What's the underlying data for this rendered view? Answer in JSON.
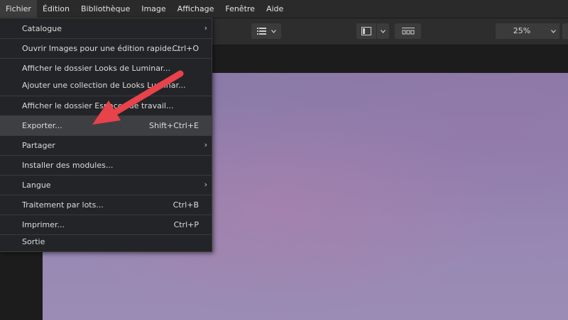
{
  "menubar": {
    "items": [
      "Fichier",
      "Édition",
      "Bibliothèque",
      "Image",
      "Affichage",
      "Fenêtre",
      "Aide"
    ]
  },
  "toolbar": {
    "zoom_value": "25%",
    "icons": [
      "list-view-icon",
      "panel-layout-icon",
      "filmstrip-icon"
    ]
  },
  "file_menu": {
    "items": [
      {
        "label": "Catalogue",
        "shortcut": "",
        "submenu": true
      },
      {
        "label": "Ouvrir Images pour une édition rapide...",
        "shortcut": "Ctrl+O",
        "submenu": false
      },
      {
        "label": "Afficher le dossier Looks de Luminar...",
        "shortcut": "",
        "submenu": false
      },
      {
        "label": "Ajouter une collection de Looks Luminar...",
        "shortcut": "",
        "submenu": false
      },
      {
        "label": "Afficher le dossier Espaces de travail...",
        "shortcut": "",
        "submenu": false
      },
      {
        "label": "Exporter...",
        "shortcut": "Shift+Ctrl+E",
        "submenu": false,
        "highlighted": true
      },
      {
        "label": "Partager",
        "shortcut": "",
        "submenu": true
      },
      {
        "label": "Installer des modules...",
        "shortcut": "",
        "submenu": false
      },
      {
        "label": "Langue",
        "shortcut": "",
        "submenu": true
      },
      {
        "label": "Traitement par lots...",
        "shortcut": "Ctrl+B",
        "submenu": false
      },
      {
        "label": "Imprimer...",
        "shortcut": "Ctrl+P",
        "submenu": false
      },
      {
        "label": "Sortie",
        "shortcut": "",
        "submenu": false
      }
    ],
    "submenu_glyph": "›"
  },
  "colors": {
    "annotation_arrow": "#e8424a",
    "menu_bg": "#232427",
    "highlight": "#3e3f43"
  }
}
